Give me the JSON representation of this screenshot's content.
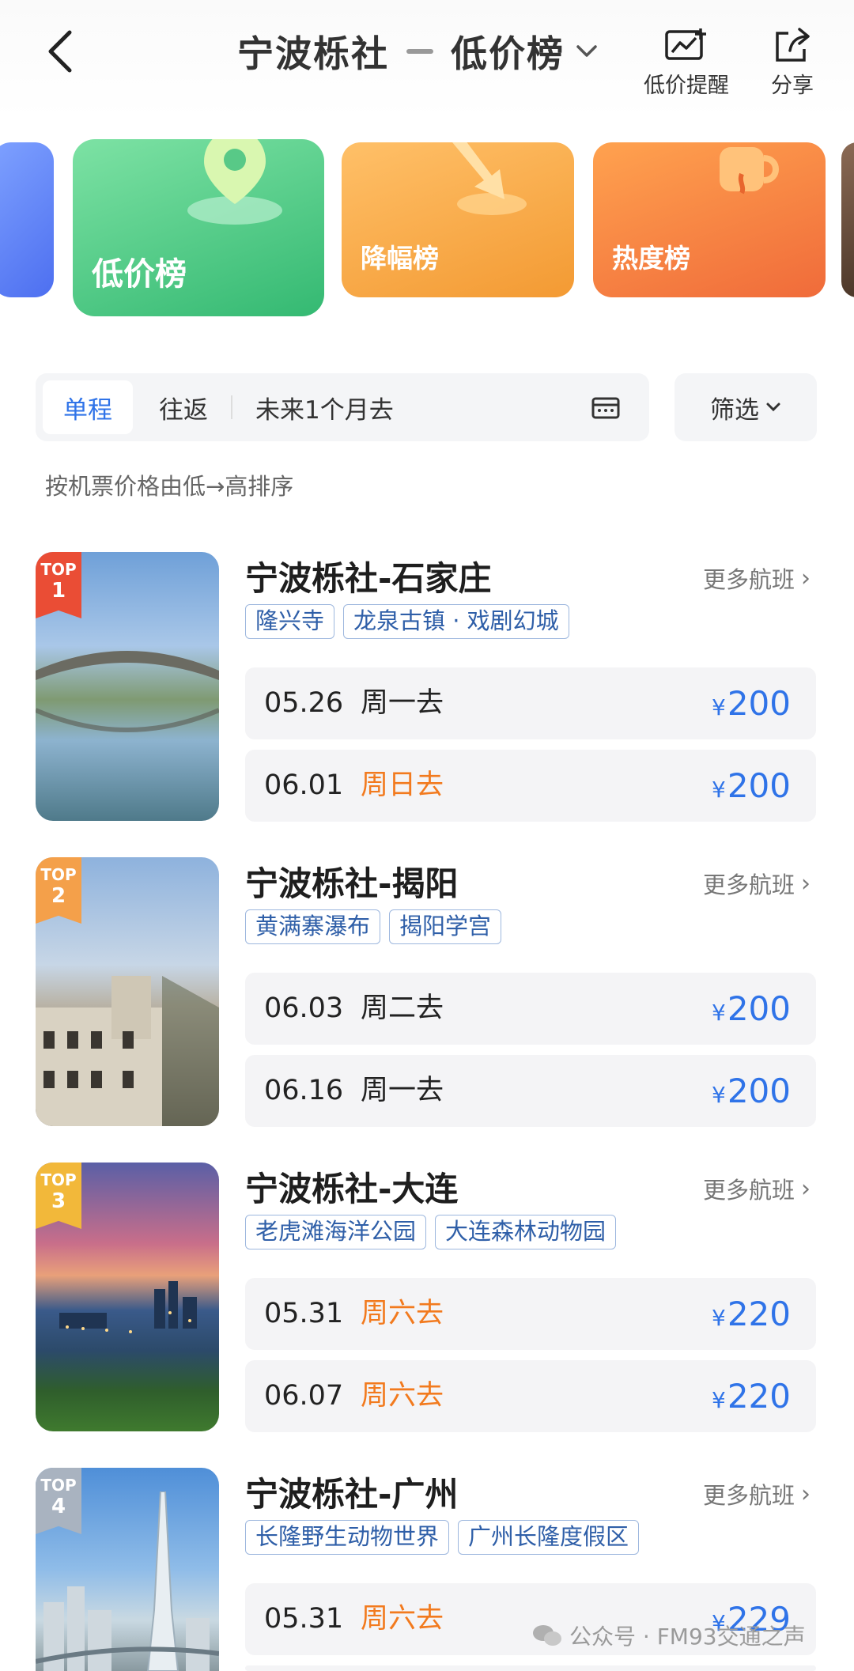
{
  "header": {
    "origin": "宁波栎社",
    "list_name": "低价榜",
    "alert_label": "低价提醒",
    "share_label": "分享"
  },
  "categories": [
    {
      "label": "低价榜",
      "active": true,
      "color": "#3dc07a"
    },
    {
      "label": "降幅榜",
      "active": false,
      "color": "#f5a03a"
    },
    {
      "label": "热度榜",
      "active": false,
      "color": "#f27a3e"
    }
  ],
  "filters": {
    "one_way": "单程",
    "round_trip": "往返",
    "date_range": "未来1个月去",
    "filter_label": "筛选"
  },
  "sort_hint": "按机票价格由低→高排序",
  "routes": [
    {
      "rank_tag": "TOP",
      "rank": "1",
      "title": "宁波栎社-石家庄",
      "more": "更多航班",
      "tags": [
        "隆兴寺",
        "龙泉古镇 · 戏剧幻城"
      ],
      "flights": [
        {
          "date": "05.26",
          "weekday": "周一去",
          "weekend": false,
          "currency": "¥",
          "price": "200"
        },
        {
          "date": "06.01",
          "weekday": "周日去",
          "weekend": true,
          "currency": "¥",
          "price": "200"
        }
      ]
    },
    {
      "rank_tag": "TOP",
      "rank": "2",
      "title": "宁波栎社-揭阳",
      "more": "更多航班",
      "tags": [
        "黄满寨瀑布",
        "揭阳学宫"
      ],
      "flights": [
        {
          "date": "06.03",
          "weekday": "周二去",
          "weekend": false,
          "currency": "¥",
          "price": "200"
        },
        {
          "date": "06.16",
          "weekday": "周一去",
          "weekend": false,
          "currency": "¥",
          "price": "200"
        }
      ]
    },
    {
      "rank_tag": "TOP",
      "rank": "3",
      "title": "宁波栎社-大连",
      "more": "更多航班",
      "tags": [
        "老虎滩海洋公园",
        "大连森林动物园"
      ],
      "flights": [
        {
          "date": "05.31",
          "weekday": "周六去",
          "weekend": true,
          "currency": "¥",
          "price": "220"
        },
        {
          "date": "06.07",
          "weekday": "周六去",
          "weekend": true,
          "currency": "¥",
          "price": "220"
        }
      ]
    },
    {
      "rank_tag": "TOP",
      "rank": "4",
      "title": "宁波栎社-广州",
      "more": "更多航班",
      "tags": [
        "长隆野生动物世界",
        "广州长隆度假区"
      ],
      "flights": [
        {
          "date": "05.31",
          "weekday": "周六去",
          "weekend": true,
          "currency": "¥",
          "price": "229"
        }
      ]
    }
  ],
  "watermark": "公众号 · FM93交通之声",
  "colors": {
    "price": "#2f73e8",
    "weekend": "#f27a1e",
    "active_tab": "#2f73e8"
  }
}
